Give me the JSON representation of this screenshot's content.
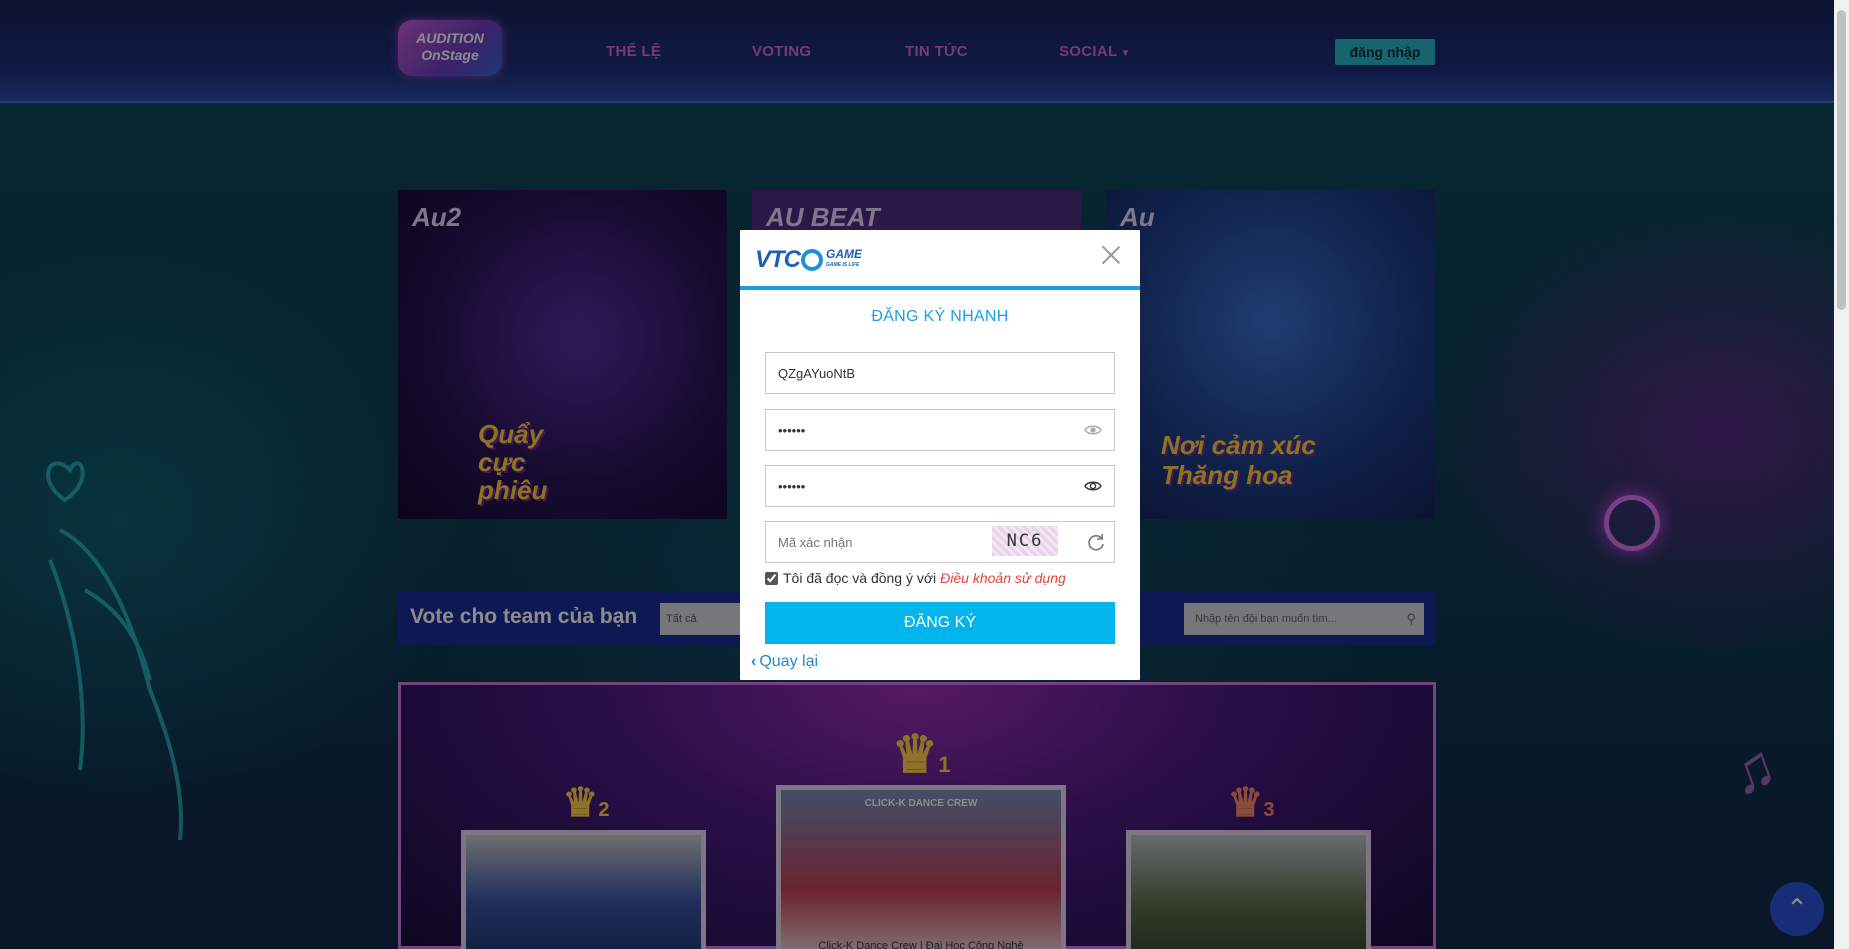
{
  "header": {
    "logo_text": "AUDITION OnStage",
    "nav": [
      {
        "label": "THỂ LỆ"
      },
      {
        "label": "VOTING"
      },
      {
        "label": "TIN TỨC"
      },
      {
        "label": "SOCIAL"
      }
    ],
    "login_label": "đăng nhập"
  },
  "banners": [
    {
      "tag": "Au2",
      "caption": "Quẩy cực phiêu"
    },
    {
      "tag": "AU BEAT",
      "caption": ""
    },
    {
      "tag": "Au",
      "caption": "Nơi cảm xúc Thăng hoa"
    }
  ],
  "vote": {
    "title": "Vote cho team của bạn",
    "filter_value": "Tất cả",
    "search_placeholder": "Nhập tên đội bạn muốn tìm..."
  },
  "teams": [
    {
      "rank": "2"
    },
    {
      "rank": "1",
      "banner": "CLICK-K DANCE CREW",
      "name": "Click-K Dance Crew | Đại Học Công Nghệ"
    },
    {
      "rank": "3"
    }
  ],
  "modal": {
    "brand": "VTC",
    "brand_sub": "GAME",
    "brand_tagline": "GAME IS LIFE",
    "title": "ĐĂNG KÝ NHANH",
    "username_value": "QZgAYuoNtB",
    "password_value": "••••••",
    "confirm_password_value": "••••••",
    "captcha_placeholder": "Mã xác nhận",
    "captcha_code": "NC6",
    "agree_text": "Tôi đã đọc và đồng ý với",
    "terms_link": "Điều khoản sử dụng",
    "agree_checked": true,
    "submit_label": "ĐĂNG KÝ",
    "back_label": "Quay lại"
  },
  "colors": {
    "accent": "#1aa0e0",
    "submit": "#00b5ec",
    "terms_link": "#e0443c",
    "nav_text": "#d56ad9"
  }
}
